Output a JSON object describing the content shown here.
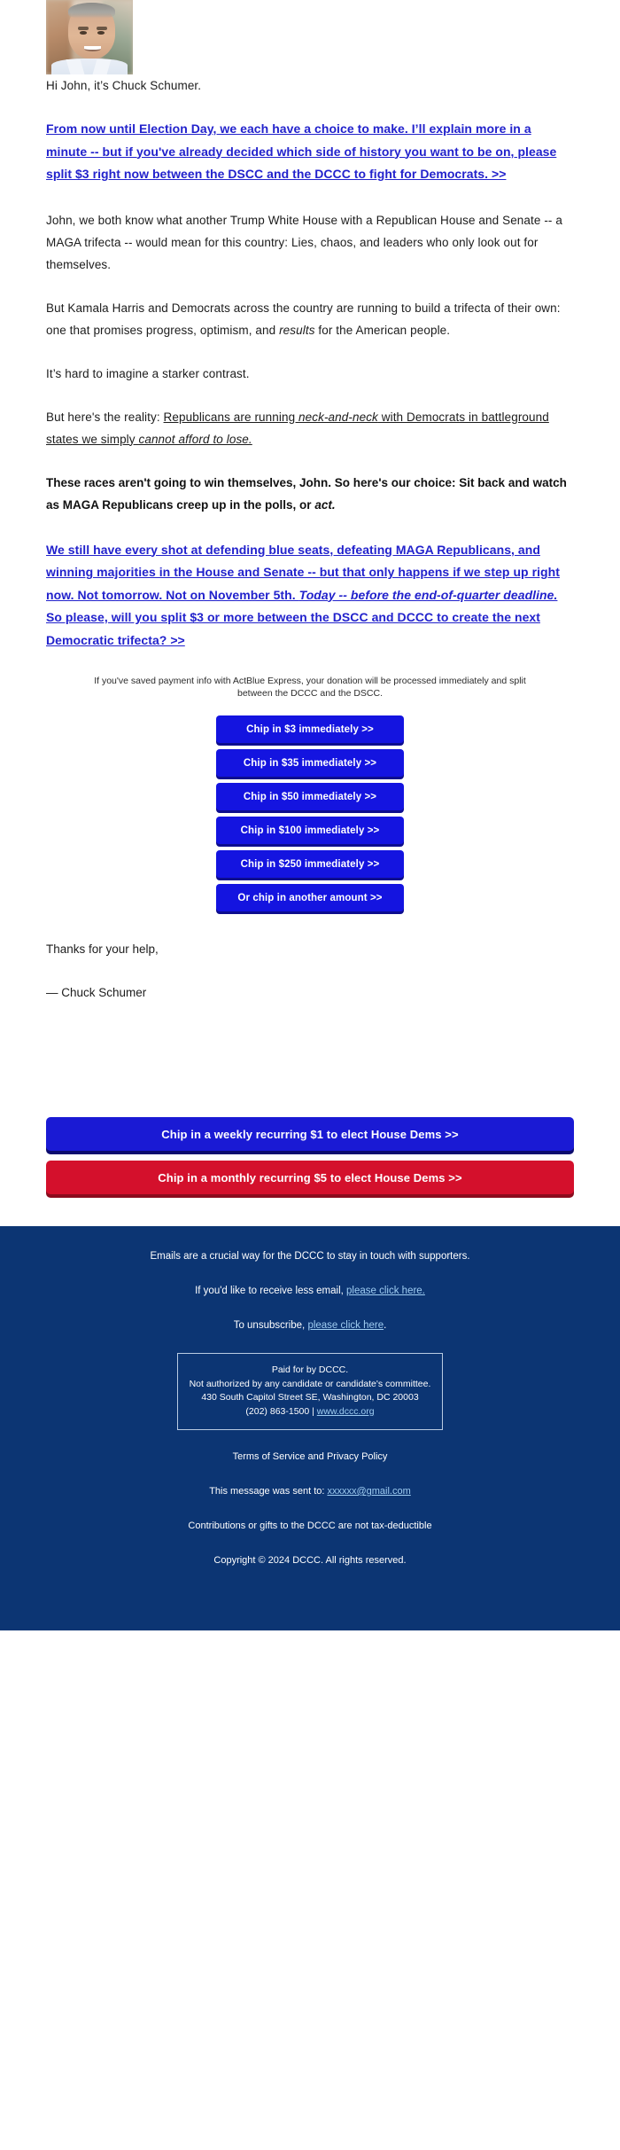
{
  "colors": {
    "link_blue": "#2222cc",
    "button_blue": "#1414e0",
    "button_blue_shadow": "#0d0d8f",
    "recurring_blue": "#1a1ad4",
    "recurring_red": "#d4102c",
    "footer_bg": "#0c3573",
    "footer_link": "#9fcdf2"
  },
  "portrait": {
    "alt": "Chuck Schumer portrait photo"
  },
  "body": {
    "greeting": "Hi John, it’s Chuck Schumer.",
    "lead_link": "From now until Election Day, we each have a choice to make. I’ll explain more in a minute -- but if you've already decided which side of history you want to be on, please split $3 right now between the DSCC and the DCCC to fight for Democrats. >>",
    "para_1": "John, we both know what another Trump White House with a Republican House and Senate -- a MAGA trifecta -- would mean for this country: Lies, chaos, and leaders who only look out for themselves.",
    "para_2_pre": "But Kamala Harris and Democrats across the country are running to build a trifecta of their own: one that promises progress, optimism, and ",
    "para_2_italic": "results",
    "para_2_post": " for the American people.",
    "para_3": "It’s hard to imagine a starker contrast.",
    "para_4_pre": "But here's the reality: ",
    "para_4_u1": "Republicans are running ",
    "para_4_u1_italic": "neck-and-neck",
    "para_4_u2": " with Democrats in battleground states we simply ",
    "para_4_u2_italic": "cannot afford to lose.",
    "para_5_pre": "These races aren't going to win themselves, John. So here's our choice: Sit back and watch as MAGA Republicans creep up in the polls, or ",
    "para_5_italic": "act.",
    "cta_link_part1": "We still have every shot at defending blue seats, defeating MAGA Republicans, and winning majorities in the House and Senate -- but that only happens if we step up right now. Not tomorrow. Not on November 5th. ",
    "cta_link_italic": "Today -- before the end-of-quarter deadline.",
    "cta_link_part2": " So please, will you split $3 or more between the DSCC and DCCC to create the next Democratic trifecta? >>",
    "signoff_thanks": "Thanks for your help,",
    "signoff_name": "— Chuck Schumer"
  },
  "actblue_note": "If you've saved payment info with ActBlue Express, your donation will be processed immediately and split between the DCCC and the DSCC.",
  "donate_buttons": [
    {
      "label": "Chip in $3 immediately >>"
    },
    {
      "label": "Chip in $35 immediately >>"
    },
    {
      "label": "Chip in $50 immediately >>"
    },
    {
      "label": "Chip in $100 immediately >>"
    },
    {
      "label": "Chip in $250 immediately >>"
    },
    {
      "label": "Or chip in another amount >>"
    }
  ],
  "recurring_buttons": [
    {
      "label": "Chip in a weekly recurring $1 to elect House Dems >>",
      "style": "blue"
    },
    {
      "label": "Chip in a monthly recurring $5 to elect House Dems >>",
      "style": "red"
    }
  ],
  "footer": {
    "line_emails": "Emails are a crucial way for the DCCC to stay in touch with supporters.",
    "less_email_pre": "If you'd like to receive less email, ",
    "less_email_link": "please click here.",
    "unsubscribe_pre": "To unsubscribe, ",
    "unsubscribe_link": "please click here",
    "unsubscribe_post": ".",
    "disclaimer_line1": "Paid for by DCCC.",
    "disclaimer_line2": "Not authorized by any candidate or candidate's committee.",
    "disclaimer_line3": "430 South Capitol Street SE, Washington, DC 20003",
    "disclaimer_phone": "(202) 863-1500 | ",
    "disclaimer_website": "www.dccc.org",
    "terms": "Terms of Service and Privacy Policy",
    "sent_to_pre": "This message was sent to: ",
    "sent_to_email": "xxxxxx@gmail.com",
    "tax_note": "Contributions or gifts to the DCCC are not tax-deductible",
    "copyright": "Copyright © 2024 DCCC. All rights reserved."
  }
}
